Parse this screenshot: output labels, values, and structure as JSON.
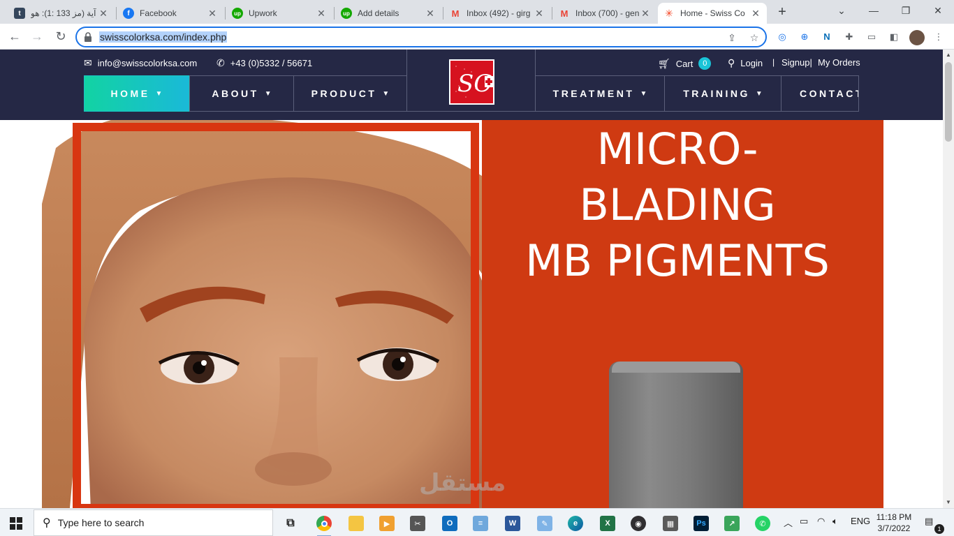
{
  "browser": {
    "tabs": [
      {
        "title": "آية (مز 133 :1): هو",
        "icon": "tumblr-icon",
        "color": "#35465c",
        "glyph": "t"
      },
      {
        "title": "Facebook",
        "icon": "facebook-icon",
        "color": "#1877f2",
        "glyph": "f"
      },
      {
        "title": "Upwork",
        "icon": "upwork-icon",
        "color": "#14a800",
        "glyph": "up"
      },
      {
        "title": "Add details",
        "icon": "upwork-icon",
        "color": "#14a800",
        "glyph": "up"
      },
      {
        "title": "Inbox (492) - girg",
        "icon": "gmail-icon",
        "color": "#ea4335",
        "glyph": "M"
      },
      {
        "title": "Inbox (700) - gen",
        "icon": "gmail-icon",
        "color": "#ea4335",
        "glyph": "M"
      },
      {
        "title": "Home - Swiss Co",
        "icon": "joomla-icon",
        "color": "#f44321",
        "glyph": "✳",
        "active": true
      }
    ],
    "new_tab": "+",
    "url": "swisscolorksa.com/index.php"
  },
  "site": {
    "email": "info@swisscolorksa.com",
    "phone": "+43 (0)5332 / 56671",
    "cart_label": "Cart",
    "cart_count": "0",
    "login": "Login",
    "signup": "Signup|",
    "separator": "|",
    "my_orders": "My Orders",
    "nav": {
      "home": "HOME",
      "about": "ABOUT",
      "product": "PRODUCT",
      "treatment": "TREATMENT",
      "training": "TRAINING",
      "contact": "CONTACT"
    },
    "logo_text": "SC",
    "hero": {
      "line1": "MICRO-",
      "line2": "BLADING",
      "line3": "MB PIGMENTS"
    }
  },
  "watermark": "مستقل",
  "taskbar": {
    "search_placeholder": "Type here to search",
    "language": "ENG",
    "time": "11:18 PM",
    "date": "3/7/2022",
    "notification_count": "1"
  },
  "colors": {
    "header_bg": "#252845",
    "hero_orange": "#cf3a12",
    "accent_teal": "#12d3a3",
    "logo_red": "#d6121f"
  }
}
